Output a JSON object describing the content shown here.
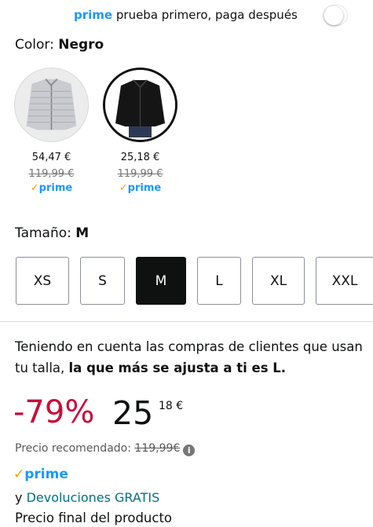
{
  "prime_banner": {
    "brand": "prime",
    "text": "prueba primero, paga después",
    "toggle_on": false
  },
  "color": {
    "label": "Color:",
    "selected": "Negro",
    "options": [
      {
        "name": "gray-jacket",
        "price": "54,47 €",
        "old_price": "119,99 €",
        "prime": "prime",
        "selected": false
      },
      {
        "name": "black-jacket",
        "price": "25,18 €",
        "old_price": "119,99 €",
        "prime": "prime",
        "selected": true
      }
    ]
  },
  "size": {
    "label": "Tamaño:",
    "selected": "M",
    "options": [
      "XS",
      "S",
      "M",
      "L",
      "XL",
      "XXL"
    ]
  },
  "fit": {
    "text": "Teniendo en cuenta las compras de clientes que usan tu talla,",
    "bold": "la que más se ajusta a ti es L."
  },
  "price": {
    "discount": "-79%",
    "whole": "25",
    "fraction": "18",
    "currency": "€",
    "recommended_label": "Precio recomendado:",
    "recommended_value": "119,99€",
    "info_icon": "i"
  },
  "prime_badge": "prime",
  "returns": {
    "prefix": "y",
    "link": "Devoluciones GRATIS"
  },
  "final_price_label": "Precio final del producto",
  "colors": {
    "prime_blue": "#1a98ff",
    "prime_check": "#ff9900",
    "discount_red": "#cc0c39",
    "link_teal": "#007185"
  }
}
